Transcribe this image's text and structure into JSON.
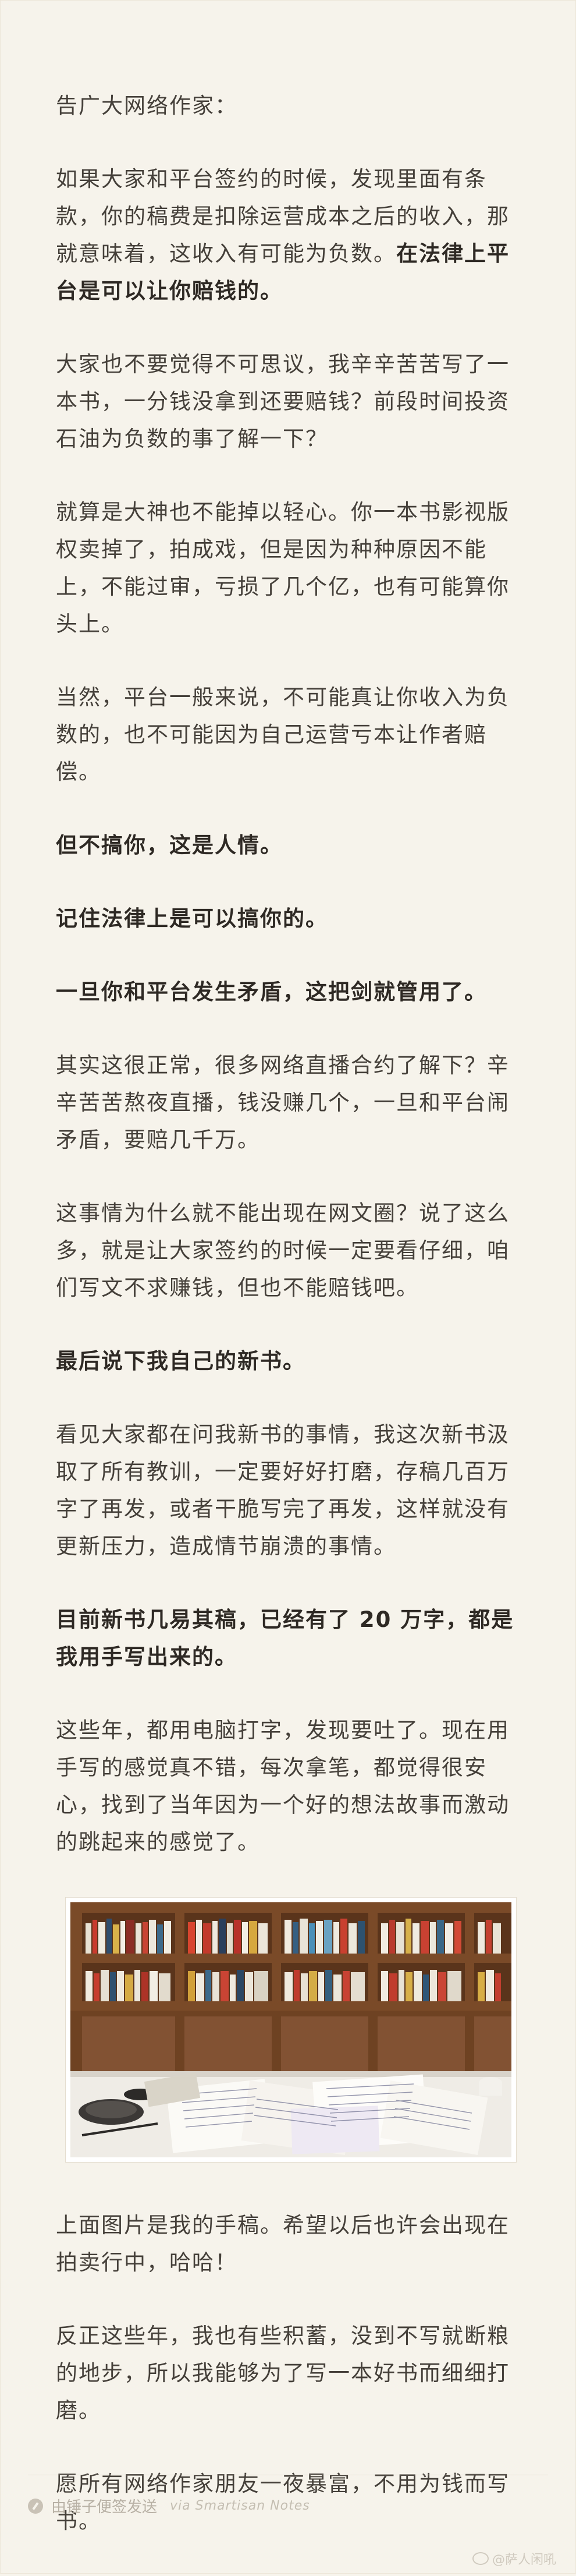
{
  "paragraphs": {
    "p0": "告广大网络作家：",
    "p1_a": "如果大家和平台签约的时候，发现里面有条款，你的稿费是扣除运营成本之后的收入，那就意味着，这收入有可能为负数。",
    "p1_b": "在法律上平台是可以让你赔钱的。",
    "p2": "大家也不要觉得不可思议，我辛辛苦苦写了一本书，一分钱没拿到还要赔钱？前段时间投资石油为负数的事了解一下？",
    "p3": "就算是大神也不能掉以轻心。你一本书影视版权卖掉了，拍成戏，但是因为种种原因不能上，不能过审，亏损了几个亿，也有可能算你头上。",
    "p4": "当然，平台一般来说，不可能真让你收入为负数的，也不可能因为自己运营亏本让作者赔偿。",
    "p5": "但不搞你，这是人情。",
    "p6": "记住法律上是可以搞你的。",
    "p7": "一旦你和平台发生矛盾，这把剑就管用了。",
    "p8": "其实这很正常，很多网络直播合约了解下？辛辛苦苦熬夜直播，钱没赚几个，一旦和平台闹矛盾，要赔几千万。",
    "p9": "这事情为什么就不能出现在网文圈？说了这么多，就是让大家签约的时候一定要看仔细，咱们写文不求赚钱，但也不能赔钱吧。",
    "p10": "最后说下我自己的新书。",
    "p11": "看见大家都在问我新书的事情，我这次新书汲取了所有教训，一定要好好打磨，存稿几百万字了再发，或者干脆写完了再发，这样就没有更新压力，造成情节崩溃的事情。",
    "p12": "目前新书几易其稿，已经有了 20 万字，都是我用手写出来的。",
    "p13": "这些年，都用电脑打字，发现要吐了。现在用手写的感觉真不错，每次拿笔，都觉得很安心，找到了当年因为一个好的想法故事而激动的跳起来的感觉了。",
    "p14": "上面图片是我的手稿。希望以后也许会出现在拍卖行中，哈哈！",
    "p15": "反正这些年，我也有些积蓄，没到不写就断粮的地步，所以我能够为了写一本好书而细细打磨。",
    "p16": "愿所有网络作家朋友一夜暴富，不用为钱而写书。"
  },
  "footer": {
    "source": "由锤子便签发送",
    "via": "via Smartisan Notes"
  },
  "watermark": {
    "text": "@萨人闲吼"
  },
  "colors": {
    "background": "#f6f3eb",
    "text": "#45403a",
    "footer_text": "#b8b1a5"
  }
}
